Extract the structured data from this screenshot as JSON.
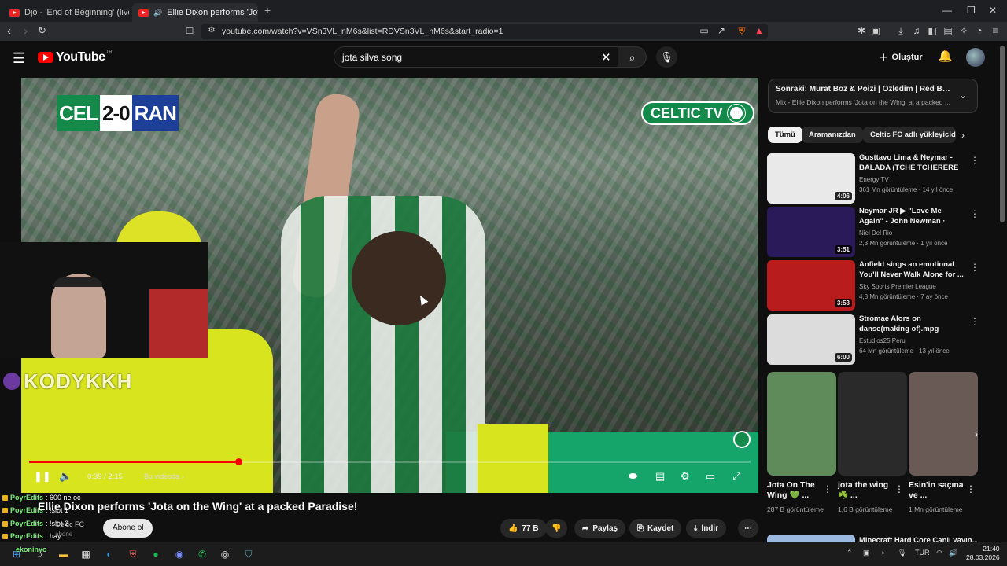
{
  "browser": {
    "tabs": [
      {
        "label": "Djo - 'End of Beginning' (live at Lanc"
      },
      {
        "label": "Ellie Dixon performs 'Jota"
      }
    ],
    "new_tab": "+",
    "url": "youtube.com/watch?v=VSn3VL_nM6s&list=RDVSn3VL_nM6s&start_radio=1"
  },
  "youtube": {
    "logo": "YouTube",
    "logo_region": "TR",
    "search_value": "jota silva song",
    "create_label": "Oluştur"
  },
  "video": {
    "score": {
      "team1": "CEL",
      "score": "2-0",
      "team2": "RAN"
    },
    "channel_bug": "CELTIC TV",
    "time_current": "0:39",
    "time_total": "2:15",
    "time_label": "0:39 / 2:15",
    "progress": 0.29,
    "chapter_label": "Bu videoda ›",
    "title": "Ellie Dixon performs 'Jota on the Wing' at a packed Paradise!",
    "channel": "Celtic FC",
    "subscribers": "abone",
    "subscribe_label": "Abone ol",
    "likes": "77 B",
    "share": "Paylaş",
    "save": "Kaydet",
    "download": "İndir"
  },
  "stream_overlay": {
    "watermark": "KODYKKH",
    "chat": [
      {
        "user": "PoyrEdits",
        "msg": ": 600 ne oc"
      },
      {
        "user": "PoyrEdits",
        "msg": ": !slot 1"
      },
      {
        "user": "PoyrEdits",
        "msg": ": !slot 2"
      },
      {
        "user": "PoyrEdits",
        "msg": ": hay"
      },
      {
        "user": "ekoninyo",
        "msg": ""
      }
    ]
  },
  "sidebar": {
    "next_title": "Sonraki: Murat Boz & Poizi | Özledim | Red Bull Trac...",
    "next_sub": "Mix - Ellie Dixon performs 'Jota on the Wing' at a packed ...",
    "chips": [
      "Tümü",
      "Aramanızdan",
      "Celtic FC adlı yükleyicid"
    ],
    "videos": [
      {
        "title": "Gusttavo Lima & Neymar - BALADA (TCHÊ TCHERERE ...",
        "channel": "Energy TV",
        "meta": "361 Mn görüntüleme · 14 yıl önce",
        "duration": "4:06",
        "color": "#e9e9e9"
      },
      {
        "title": "Neymar JR ▶ \"Love Me Again\" - John Newman · Skills & Goals ...",
        "channel": "Niel Del Rio",
        "meta": "2,3 Mn görüntüleme · 1 yıl önce",
        "duration": "3:51",
        "color": "#2a1a5a"
      },
      {
        "title": "Anfield sings an emotional You'll Never Walk Alone for ...",
        "channel": "Sky Sports Premier League",
        "meta": "4,8 Mn görüntüleme · 7 ay önce",
        "duration": "3:53",
        "color": "#b81c1c"
      },
      {
        "title": "Stromae   Alors on danse(making of).mpg",
        "channel": "Estudios25 Peru",
        "meta": "64 Mn görüntüleme · 13 yıl önce",
        "duration": "6:00",
        "color": "#dcdcdc"
      }
    ],
    "shorts": [
      {
        "title": "Jota On The Wing 💚 ...",
        "views": "287 B görüntüleme",
        "color": "#5f8a5a"
      },
      {
        "title": "jota the wing ☘️ ...",
        "views": "1,6 B görüntüleme",
        "color": "#2a2a2a"
      },
      {
        "title": "Esin'in saçına ve ...",
        "views": "1 Mn görüntüleme",
        "color": "#6a5a55"
      }
    ],
    "more_title": "Minecraft Hard Core Canlı yayın..."
  },
  "taskbar": {
    "lang": "TUR",
    "time": "21:40",
    "date": "28.03.2026"
  }
}
